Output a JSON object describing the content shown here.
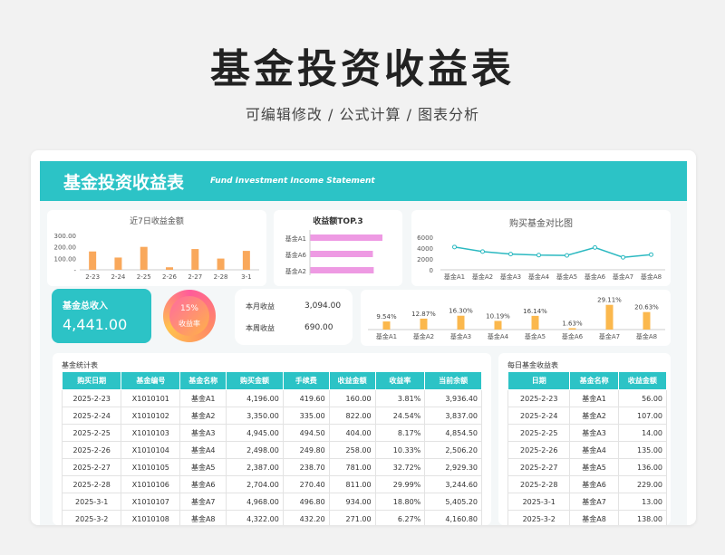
{
  "header": {
    "title": "基金投资收益表",
    "subtitle": "可编辑修改 /  公式计算  /  图表分析"
  },
  "banner": {
    "title": "基金投资收益表",
    "subtitle": "Fund Investment Income Statement"
  },
  "colors": {
    "accent": "#2cc3c6",
    "bar_orange": "#f9a85b",
    "bar_pink": "#ee9ae3",
    "line_teal": "#2cb9c1"
  },
  "summary": {
    "income_label": "基金总收入",
    "income_value": "4,441.00",
    "rate_pct": "15%",
    "rate_label": "收益率",
    "month_label": "本月收益",
    "month_value": "3,094.00",
    "week_label": "本周收益",
    "week_value": "690.00"
  },
  "chart_data": [
    {
      "type": "bar",
      "title": "近7日收益金额",
      "categories": [
        "2-23",
        "2-24",
        "2-25",
        "2-26",
        "2-27",
        "2-28",
        "3-1"
      ],
      "values": [
        160,
        107,
        200,
        22,
        181,
        98,
        165
      ],
      "yticks": [
        "300.00",
        "200.00",
        "100.00",
        "-"
      ],
      "ylim": [
        0,
        300
      ]
    },
    {
      "type": "bar",
      "title": "收益额TOP.3",
      "orientation": "horizontal",
      "categories": [
        "基金A1",
        "基金A6",
        "基金A2"
      ],
      "values": [
        934,
        811,
        822
      ]
    },
    {
      "type": "line",
      "title": "购买基金对比图",
      "categories": [
        "基金A1",
        "基金A2",
        "基金A3",
        "基金A4",
        "基金A5",
        "基金A6",
        "基金A7",
        "基金A8"
      ],
      "values": [
        4196,
        3350,
        2900,
        2700,
        2650,
        4100,
        2300,
        2800
      ],
      "yticks": [
        "6000",
        "4000",
        "2000",
        "0"
      ],
      "ylim": [
        0,
        6000
      ]
    },
    {
      "type": "bar",
      "title": "",
      "categories": [
        "基金A1",
        "基金A2",
        "基金A3",
        "基金A4",
        "基金A5",
        "基金A6",
        "基金A7",
        "基金A8"
      ],
      "values": [
        9.54,
        12.87,
        16.3,
        10.19,
        16.14,
        1.63,
        29.11,
        20.63
      ],
      "labels": [
        "9.54%",
        "12.87%",
        "16.30%",
        "10.19%",
        "16.14%",
        "1.63%",
        "29.11%",
        "20.63%"
      ],
      "ylim": [
        0,
        32
      ]
    }
  ],
  "stats_table": {
    "title": "基金统计表",
    "columns": [
      "购买日期",
      "基金编号",
      "基金名称",
      "购买金额",
      "手续费",
      "收益金额",
      "收益率",
      "当前余额"
    ],
    "rows": [
      [
        "2025-2-23",
        "X1010101",
        "基金A1",
        "4,196.00",
        "419.60",
        "160.00",
        "3.81%",
        "3,936.40"
      ],
      [
        "2025-2-24",
        "X1010102",
        "基金A2",
        "3,350.00",
        "335.00",
        "822.00",
        "24.54%",
        "3,837.00"
      ],
      [
        "2025-2-25",
        "X1010103",
        "基金A3",
        "4,945.00",
        "494.50",
        "404.00",
        "8.17%",
        "4,854.50"
      ],
      [
        "2025-2-26",
        "X1010104",
        "基金A4",
        "2,498.00",
        "249.80",
        "258.00",
        "10.33%",
        "2,506.20"
      ],
      [
        "2025-2-27",
        "X1010105",
        "基金A5",
        "2,387.00",
        "238.70",
        "781.00",
        "32.72%",
        "2,929.30"
      ],
      [
        "2025-2-28",
        "X1010106",
        "基金A6",
        "2,704.00",
        "270.40",
        "811.00",
        "29.99%",
        "3,244.60"
      ],
      [
        "2025-3-1",
        "X1010107",
        "基金A7",
        "4,968.00",
        "496.80",
        "934.00",
        "18.80%",
        "5,405.20"
      ],
      [
        "2025-3-2",
        "X1010108",
        "基金A8",
        "4,322.00",
        "432.20",
        "271.00",
        "6.27%",
        "4,160.80"
      ]
    ]
  },
  "daily_table": {
    "title": "每日基金收益表",
    "columns": [
      "日期",
      "基金名称",
      "收益金额"
    ],
    "rows": [
      [
        "2025-2-23",
        "基金A1",
        "56.00"
      ],
      [
        "2025-2-24",
        "基金A2",
        "107.00"
      ],
      [
        "2025-2-25",
        "基金A3",
        "14.00"
      ],
      [
        "2025-2-26",
        "基金A4",
        "135.00"
      ],
      [
        "2025-2-27",
        "基金A5",
        "136.00"
      ],
      [
        "2025-2-28",
        "基金A6",
        "229.00"
      ],
      [
        "2025-3-1",
        "基金A7",
        "13.00"
      ],
      [
        "2025-3-2",
        "基金A8",
        "138.00"
      ]
    ]
  }
}
